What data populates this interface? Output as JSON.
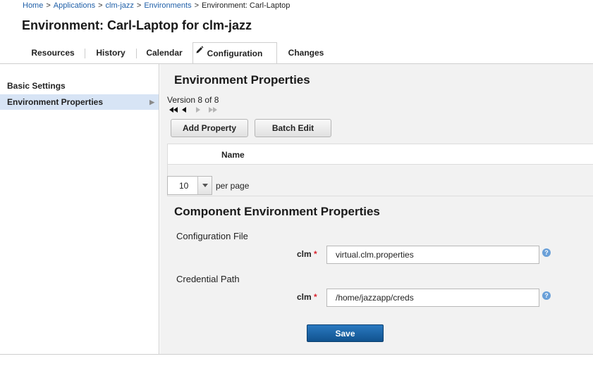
{
  "breadcrumb": {
    "items": [
      "Home",
      "Applications",
      "clm-jazz",
      "Environments"
    ],
    "separator": ">",
    "current": "Environment: Carl-Laptop"
  },
  "page": {
    "title": "Environment: Carl-Laptop for clm-jazz"
  },
  "tabs": [
    {
      "label": "Resources",
      "active": false
    },
    {
      "label": "History",
      "active": false
    },
    {
      "label": "Calendar",
      "active": false
    },
    {
      "label": "Configuration",
      "active": true,
      "icon": "pencil-icon"
    },
    {
      "label": "Changes",
      "active": false
    }
  ],
  "sidebar": {
    "items": [
      {
        "label": "Basic Settings",
        "selected": false
      },
      {
        "label": "Environment Properties",
        "selected": true,
        "icon": "triangle-right-icon"
      }
    ]
  },
  "env_properties": {
    "heading": "Environment Properties",
    "version_text": "Version 8 of 8",
    "nav_icons": [
      "first-icon",
      "previous-icon",
      "next-icon",
      "last-icon"
    ],
    "add_button": "Add Property",
    "batch_button": "Batch Edit",
    "table": {
      "columns": [
        "Name"
      ],
      "rows": []
    },
    "pager": {
      "page_size": "10",
      "per_page_label": "per page",
      "dropdown_icon": "caret-down-icon"
    }
  },
  "component_properties": {
    "heading": "Component Environment Properties",
    "fields": [
      {
        "section_label": "Configuration File",
        "name": "clm",
        "required_mark": "*",
        "value": "virtual.clm.properties",
        "help_icon": "help-icon",
        "help_glyph": "?"
      },
      {
        "section_label": "Credential Path",
        "name": "clm",
        "required_mark": "*",
        "value": "/home/jazzapp/creds",
        "help_icon": "help-icon",
        "help_glyph": "?"
      }
    ],
    "save_button": "Save"
  },
  "colors": {
    "link": "#1f5fa8",
    "selected_row": "#d7e4f5",
    "panel_bg": "#f2f2f2",
    "save_button": "#1a65a8",
    "required": "#d9232e",
    "help_icon": "#6aa0d8"
  }
}
